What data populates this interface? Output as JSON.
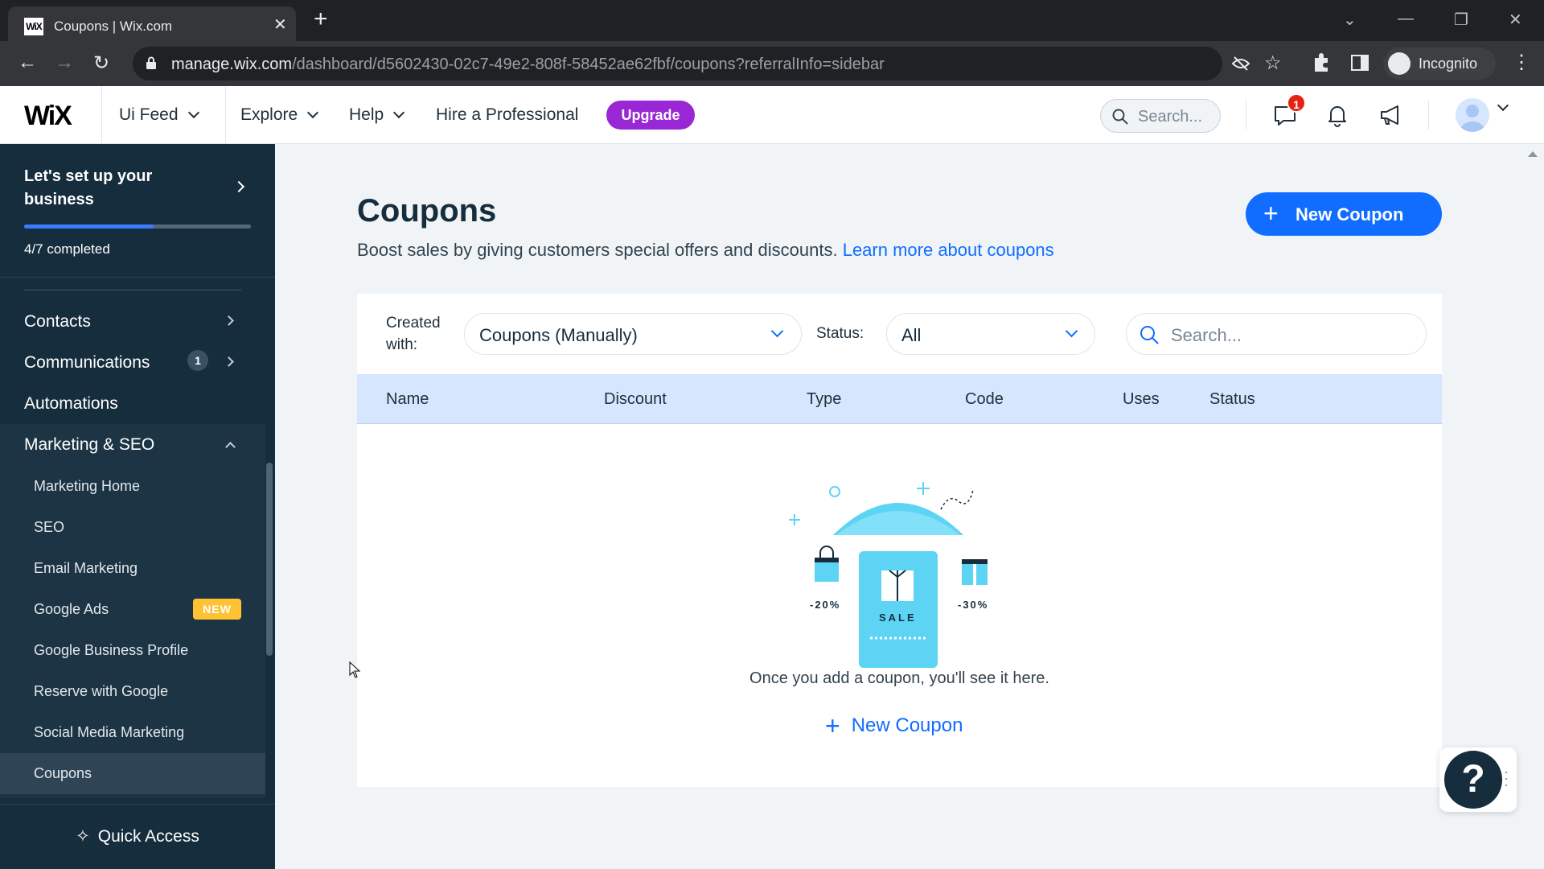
{
  "browser": {
    "tab_title": "Coupons | Wix.com",
    "favicon_text": "WiX",
    "url_host": "manage.wix.com",
    "url_path": "/dashboard/d5602430-02c7-49e2-808f-58452ae62fbf/coupons?referralInfo=sidebar",
    "profile_label": "Incognito"
  },
  "topbar": {
    "logo": "WiX",
    "site_name": "Ui Feed",
    "menu": [
      "Explore",
      "Help",
      "Hire a Professional"
    ],
    "upgrade_label": "Upgrade",
    "search_placeholder": "Search...",
    "messages_badge": "1"
  },
  "sidebar": {
    "setup_title": "Let's set up your business",
    "setup_progress_text": "4/7 completed",
    "setup_progress_fraction": 0.57,
    "items": [
      {
        "label": "Contacts"
      },
      {
        "label": "Communications",
        "badge": "1"
      },
      {
        "label": "Automations"
      },
      {
        "label": "Marketing & SEO"
      }
    ],
    "marketing_subitems": [
      {
        "label": "Marketing Home"
      },
      {
        "label": "SEO"
      },
      {
        "label": "Email Marketing"
      },
      {
        "label": "Google Ads",
        "badge": "NEW"
      },
      {
        "label": "Google Business Profile"
      },
      {
        "label": "Reserve with Google"
      },
      {
        "label": "Social Media Marketing"
      },
      {
        "label": "Coupons",
        "active": true
      }
    ],
    "quick_access": "Quick Access"
  },
  "page": {
    "title": "Coupons",
    "subtitle": "Boost sales by giving customers special offers and discounts.",
    "learn_more": "Learn more about coupons",
    "new_coupon_button": "New Coupon"
  },
  "filters": {
    "created_with_label": "Created with:",
    "created_with_value": "Coupons (Manually)",
    "status_label": "Status:",
    "status_value": "All",
    "search_placeholder": "Search..."
  },
  "table": {
    "columns": [
      "Name",
      "Discount",
      "Type",
      "Code",
      "Uses",
      "Status"
    ]
  },
  "empty_state": {
    "illustration_texts": [
      "-20%",
      "SALE",
      "-30%"
    ],
    "message": "Once you add a coupon, you'll see it here.",
    "add_label": "New Coupon"
  },
  "colors": {
    "sidebar_bg": "#162d3d",
    "accent_blue": "#116dff",
    "upgrade_purple": "#9a27d5",
    "table_header": "#d6e6fe",
    "new_badge": "#ffc233",
    "illustration_cyan": "#5ed4f5"
  }
}
